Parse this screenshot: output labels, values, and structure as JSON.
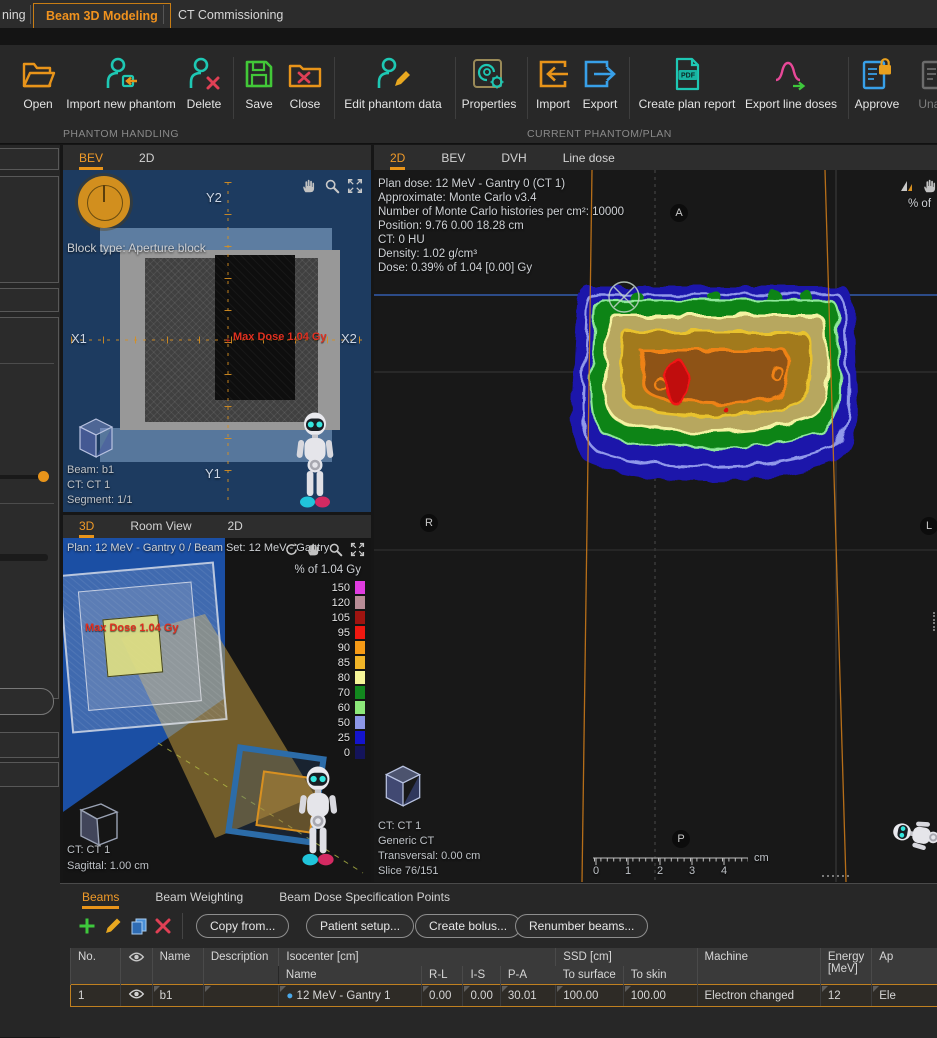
{
  "top_tabs": {
    "partial": "ning",
    "beam3d": "Beam 3D Modeling",
    "ct_comm": "CT Commissioning"
  },
  "toolbar": {
    "open": "Open",
    "import_new_phantom": "Import new phantom",
    "delete": "Delete",
    "save": "Save",
    "close": "Close",
    "edit_phantom_data": "Edit phantom data",
    "properties": "Properties",
    "import": "Import",
    "export": "Export",
    "create_plan_report": "Create plan report",
    "export_line_doses": "Export line doses",
    "approve": "Approve",
    "unapprove": "Unapp",
    "pdf_badge": "PDF",
    "section_left": "PHANTOM HANDLING",
    "section_right": "CURRENT PHANTOM/PLAN"
  },
  "bev": {
    "tab_bev": "BEV",
    "tab_2d": "2D",
    "block_type": "Block type: Aperture block",
    "y2": "Y2",
    "y1": "Y1",
    "x1": "X1",
    "x2": "X2",
    "max_dose": "Max Dose 1.04 Gy",
    "beam": "Beam: b1",
    "ct": "CT: CT 1",
    "segment": "Segment: 1/1"
  },
  "view3d": {
    "tab_3d": "3D",
    "tab_room": "Room View",
    "tab_2d": "2D",
    "plan_line": "Plan: 12 MeV - Gantry 0 / Beam Set: 12 MeV - Gantry",
    "scale_title": "% of 1.04 Gy",
    "max_dose": "Max Dose 1.04 Gy",
    "ct": "CT: CT 1",
    "plane": "Sagittal: 1.00 cm",
    "colorbar": [
      {
        "label": "150",
        "css": "background:#e03ce0"
      },
      {
        "label": "120",
        "css": "background:#b88c96"
      },
      {
        "label": "105",
        "css": "background:#a01410"
      },
      {
        "label": "95",
        "css": "background:#f01810"
      },
      {
        "label": "90",
        "css": "background:#f59a16"
      },
      {
        "label": "85",
        "css": "background:#f0b428"
      },
      {
        "label": "80",
        "css": "background:#f5f598"
      },
      {
        "label": "70",
        "css": "background:#12881e"
      },
      {
        "label": "60",
        "css": "background:#8ce87a"
      },
      {
        "label": "50",
        "css": "background:#8c96e8"
      },
      {
        "label": "25",
        "css": "background:#1414cc"
      },
      {
        "label": "0",
        "css": "background:#14145a"
      }
    ]
  },
  "dose2d": {
    "tab_2d": "2D",
    "tab_bev": "BEV",
    "tab_dvh": "DVH",
    "tab_line": "Line dose",
    "info": [
      "Plan dose: 12 MeV - Gantry 0 (CT 1)",
      "Approximate: Monte Carlo v3.4",
      "Number of Monte Carlo histories per cm²: 10000",
      "Position: 9.76 0.00 18.28 cm",
      "CT: 0 HU",
      "Density: 1.02 g/cm³",
      "Dose: 0.39% of 1.04 [0.00] Gy"
    ],
    "scale_partial": "% of",
    "a": "A",
    "r": "R",
    "l": "L",
    "p": "P",
    "ct": "CT: CT 1",
    "ct_name": "Generic CT",
    "plane": "Transversal: 0.00 cm",
    "slice": "Slice 76/151",
    "ruler_ticks": [
      "0",
      "1",
      "2",
      "3",
      "4"
    ],
    "ruler_unit": "cm"
  },
  "beams": {
    "tab_beams": "Beams",
    "tab_weighting": "Beam Weighting",
    "tab_spec": "Beam Dose Specification Points",
    "btn_copy": "Copy from...",
    "btn_setup": "Patient setup...",
    "btn_bolus": "Create bolus...",
    "btn_renumber": "Renumber beams...",
    "h": {
      "no": "No.",
      "name": "Name",
      "desc": "Description",
      "iso": "Isocenter [cm]",
      "iso_name": "Name",
      "rl": "R-L",
      "is": "I-S",
      "pa": "P-A",
      "ssd": "SSD [cm]",
      "surf": "To surface",
      "skin": "To skin",
      "machine": "Machine",
      "energy1": "Energy",
      "energy2": "[MeV]",
      "ap": "Ap"
    },
    "row": {
      "no": "1",
      "name": "b1",
      "desc": "",
      "iso_name": "12 MeV - Gantry 1",
      "rl": "0.00",
      "is": "0.00",
      "pa": "30.01",
      "surf": "100.00",
      "skin": "100.00",
      "machine": "Electron changed",
      "energy": "12",
      "ap": "Ele"
    }
  }
}
